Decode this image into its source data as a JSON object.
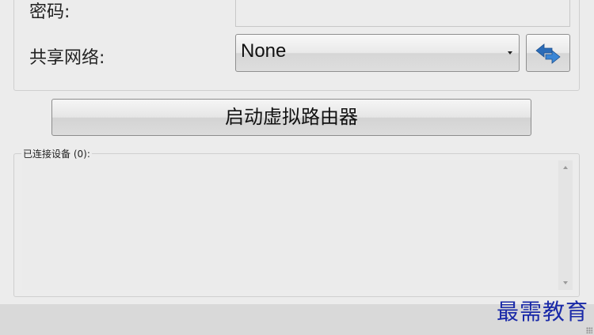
{
  "form": {
    "password_label": "密码:",
    "password_value": "",
    "share_label": "共享网络:",
    "share_selected": "None"
  },
  "actions": {
    "start_button_label": "启动虚拟路由器",
    "refresh_icon": "refresh-arrows-icon"
  },
  "devices": {
    "group_label": "已连接设备 (0):",
    "items": []
  },
  "watermark": {
    "text": "最需教育"
  },
  "colors": {
    "accent_blue": "#2b6cb8",
    "watermark": "#1a2aa8"
  }
}
